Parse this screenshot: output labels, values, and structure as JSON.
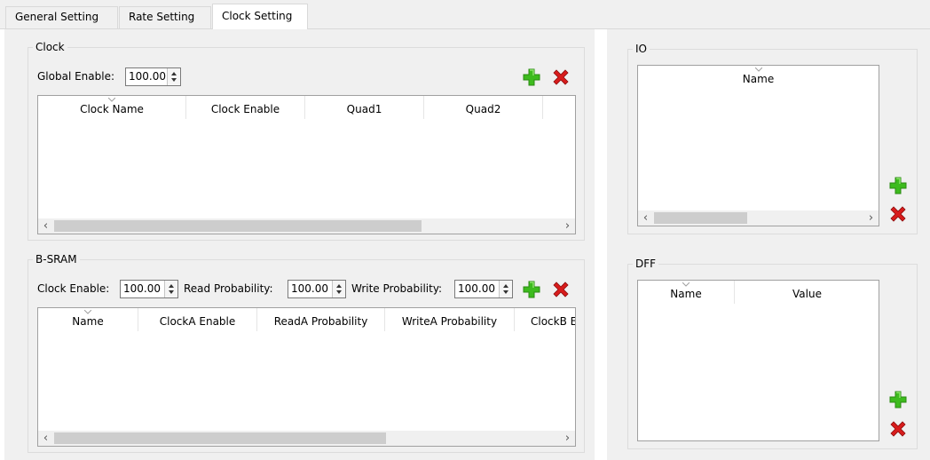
{
  "tabs": [
    "General Setting",
    "Rate Setting",
    "Clock Setting"
  ],
  "clock": {
    "title": "Clock",
    "global_enable_label": "Global Enable:",
    "global_enable_value": "100.00",
    "columns": [
      "Clock Name",
      "Clock Enable",
      "Quad1",
      "Quad2"
    ]
  },
  "bsram": {
    "title": "B-SRAM",
    "clock_enable_label": "Clock Enable:",
    "clock_enable_value": "100.00",
    "read_prob_label": "Read Probability:",
    "read_prob_value": "100.00",
    "write_prob_label": "Write Probability:",
    "write_prob_value": "100.00",
    "columns": [
      "Name",
      "ClockA Enable",
      "ReadA Probability",
      "WriteA Probability",
      "ClockB E"
    ]
  },
  "io": {
    "title": "IO",
    "columns": [
      "Name"
    ]
  },
  "dff": {
    "title": "DFF",
    "columns": [
      "Name",
      "Value"
    ]
  },
  "scroll_left_glyph": "‹",
  "scroll_right_glyph": "›",
  "colors": {
    "add": "#3dbb1e",
    "delete": "#d81c1c"
  },
  "icons": [
    "plus-icon",
    "delete-x-icon",
    "sort-chevron-icon",
    "spin-up-icon",
    "spin-down-icon"
  ]
}
